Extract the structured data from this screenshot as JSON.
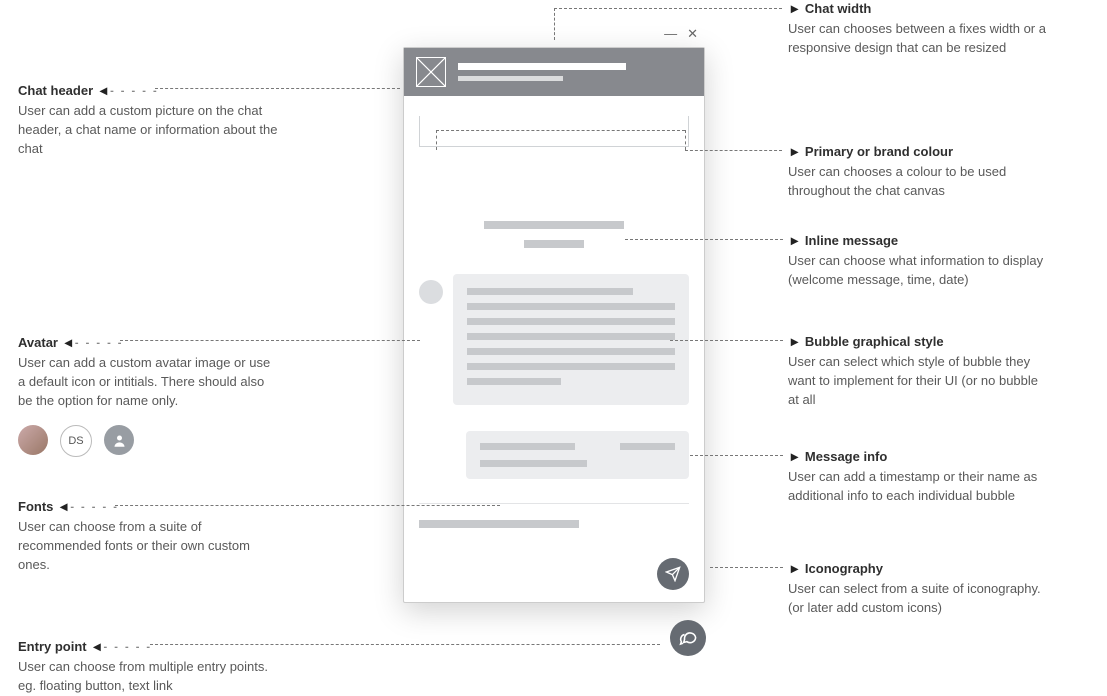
{
  "annotations": {
    "chatHeader": {
      "title": "Chat header",
      "desc": "User can add a custom picture on the chat header, a chat name or information about the chat"
    },
    "avatar": {
      "title": "Avatar",
      "desc": "User can add a custom avatar image or use a default icon or intitials. There should also be the option for name only."
    },
    "fonts": {
      "title": "Fonts",
      "desc": "User can choose from a suite of recommended fonts or their own custom ones."
    },
    "entryPoint": {
      "title": "Entry point",
      "desc": "User can choose from multiple entry points. eg. floating button, text link"
    },
    "chatWidth": {
      "title": "Chat width",
      "desc": "User can chooses between a fixes width or a responsive design that can be resized"
    },
    "primaryColour": {
      "title": "Primary or brand colour",
      "desc": "User can chooses a colour to be used throughout the chat canvas"
    },
    "inlineMessage": {
      "title": "Inline message",
      "desc": "User can choose what information to display (welcome message, time, date)"
    },
    "bubbleStyle": {
      "title": "Bubble graphical style",
      "desc": "User can select which style of bubble they want to implement for their UI (or no bubble at all"
    },
    "messageInfo": {
      "title": "Message info",
      "desc": "User can add a timestamp or their name as additional info to each individual bubble"
    },
    "iconography": {
      "title": "Iconography",
      "desc": "User can select from a suite of iconography. (or later add custom icons)"
    }
  },
  "avatarExamples": {
    "initials": "DS"
  },
  "window": {
    "minimize": "—",
    "close": "✕"
  }
}
